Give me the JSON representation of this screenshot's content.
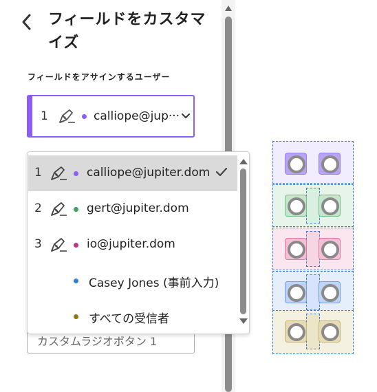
{
  "panel": {
    "title": "フィールドをカスタマイズ",
    "assign_label": "フィールドをアサインするユーザー",
    "selected": {
      "number": "1",
      "email": "calliope@jup···",
      "dot_color": "#8b5cf6"
    },
    "field_name": "カスタムラジオボタン 1"
  },
  "dropdown": {
    "options": [
      {
        "number": "1",
        "label": "calliope@jupiter.dom",
        "dot_color": "#8b5cf6",
        "selected": true,
        "signer_icon": "signature-pen-icon"
      },
      {
        "number": "2",
        "label": "gert@jupiter.dom",
        "dot_color": "#3da35d",
        "selected": false,
        "signer_icon": "signature-pen-icon"
      },
      {
        "number": "3",
        "label": "io@jupiter.dom",
        "dot_color": "#c2338a",
        "selected": false,
        "signer_icon": "signature-pen-icon"
      },
      {
        "number": "",
        "label": "Casey Jones (事前入力)",
        "dot_color": "#2f7de1",
        "selected": false
      },
      {
        "number": "",
        "label": "すべての受信者",
        "dot_color": "#8a7b00",
        "selected": false
      }
    ]
  },
  "canvas": {
    "rows": [
      {
        "bg": "#f1ecfe",
        "cell": "#b9a3f4",
        "border": "#9b80e8"
      },
      {
        "bg": "#e7f4ea",
        "cell": "#c3e6cc",
        "border": "#72c083"
      },
      {
        "bg": "#fbe6ef",
        "cell": "#f5bfd5",
        "border": "#df7aa6"
      },
      {
        "bg": "#e6eefc",
        "cell": "#c0d4f5",
        "border": "#6f9ee6"
      },
      {
        "bg": "#f4f1e0",
        "cell": "#e6dcb4",
        "border": "#c4b378"
      }
    ]
  },
  "colors": {
    "accent": "#8b5cf6",
    "selection": "#3b7dd8"
  }
}
